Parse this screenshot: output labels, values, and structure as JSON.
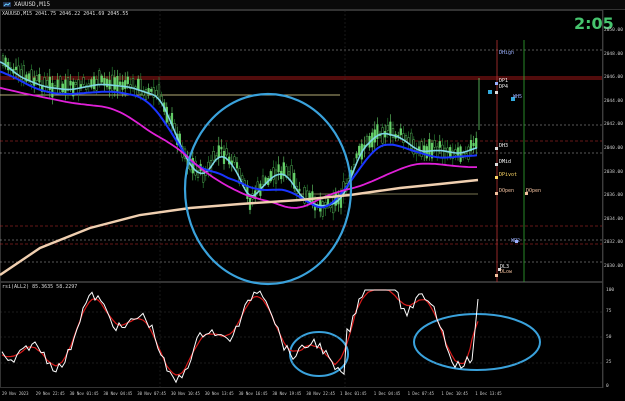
{
  "window": {
    "title": "XAUUSD,M15",
    "ohlc": "XAUUSD,M15  2041.75 2046.22 2041.69 2045.55"
  },
  "clock": "2:05",
  "price_axis": [
    "2050.00",
    "2048.00",
    "2046.00",
    "2044.00",
    "2042.00",
    "2040.00",
    "2038.00",
    "2036.00",
    "2034.00",
    "2032.00",
    "2030.00"
  ],
  "levels": [
    {
      "label": "DHigh",
      "color": "#9ab0ff"
    },
    {
      "label": "DP1",
      "color": "#f2f2f2"
    },
    {
      "label": "DP4",
      "color": "#f2f2f2"
    },
    {
      "label": "WH5",
      "color": "#9ab0ff"
    },
    {
      "label": "DH3",
      "color": "#f2f2f2"
    },
    {
      "label": "DMid",
      "color": "#f2f2f2"
    },
    {
      "label": "DPivot",
      "color": "#ffd966"
    },
    {
      "label": "DOpen",
      "color": "#f2c09e"
    },
    {
      "label": "DOpen",
      "color": "#f2c09e"
    },
    {
      "label": "WP2",
      "color": "#9ab0ff"
    },
    {
      "label": "DL3",
      "color": "#f2f2f2"
    },
    {
      "label": "DLow",
      "color": "#f2c09e"
    }
  ],
  "time_axis": [
    "29 Nov 2023",
    "29 Nov 22:45",
    "30 Nov 01:45",
    "30 Nov 04:45",
    "30 Nov 07:45",
    "30 Nov 10:45",
    "30 Nov 13:45",
    "30 Nov 16:45",
    "30 Nov 19:45",
    "30 Nov 22:45",
    "1 Dec 01:45",
    "1 Dec 04:45",
    "1 Dec 07:45",
    "1 Dec 10:45",
    "1 Dec 13:45"
  ],
  "indicator": {
    "title": "rsi(ALL2) 85.3635 58.2297",
    "axis": [
      "100",
      "75",
      "50",
      "25",
      "0"
    ]
  },
  "colors": {
    "bull": "#66d36a",
    "ma_cyan": "#7fd6e6",
    "ma_blue": "#1a35ff",
    "ma_magenta": "#e020d8",
    "ma_peach": "#f0cfb0",
    "circle": "#3aa2dc",
    "rsi_white": "#ffffff",
    "rsi_red": "#d81a1a"
  },
  "icons": [
    "chart-window-icon"
  ]
}
